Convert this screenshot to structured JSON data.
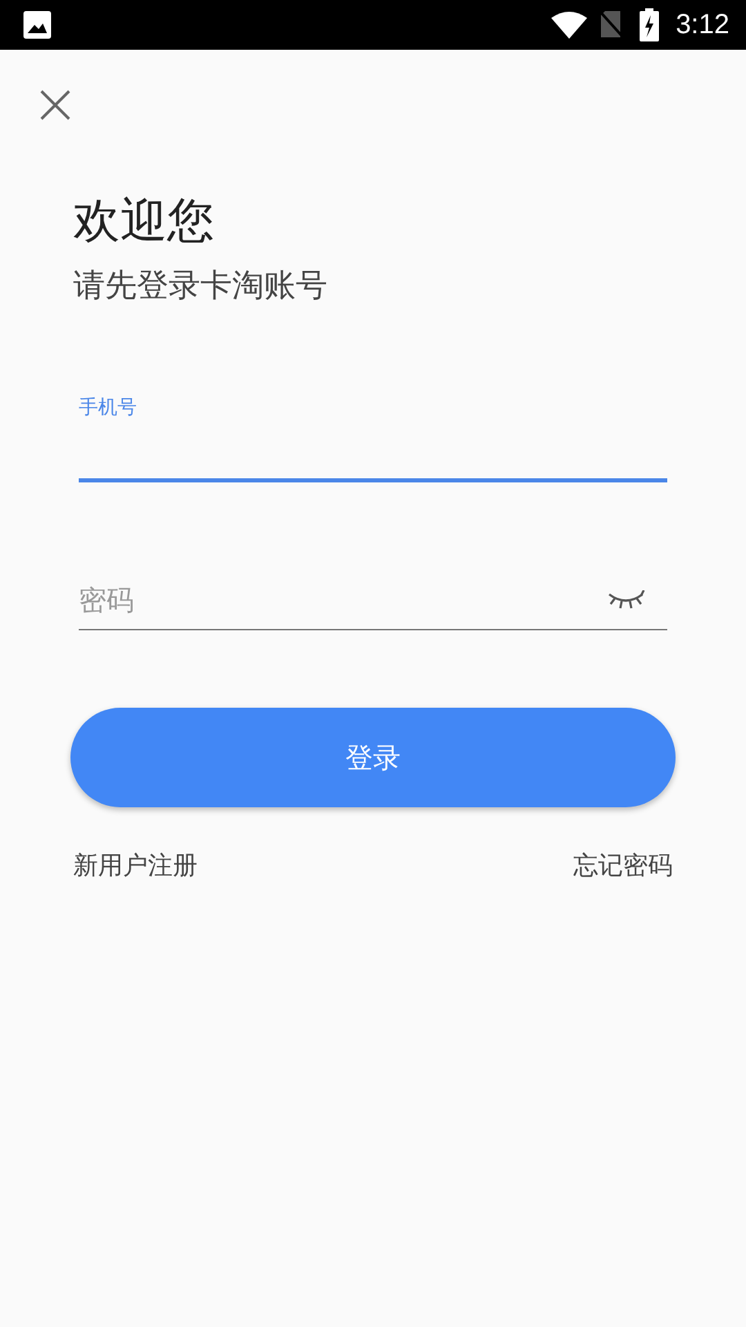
{
  "status_bar": {
    "time": "3:12"
  },
  "welcome": {
    "title": "欢迎您",
    "subtitle": "请先登录卡淘账号"
  },
  "fields": [
    {
      "kind": "phone",
      "label": "手机号",
      "focused": true
    },
    {
      "kind": "password",
      "placeholder": "密码",
      "focused": false
    }
  ],
  "login_button": "登录",
  "links": [
    "新用户注册",
    "忘记密码"
  ]
}
